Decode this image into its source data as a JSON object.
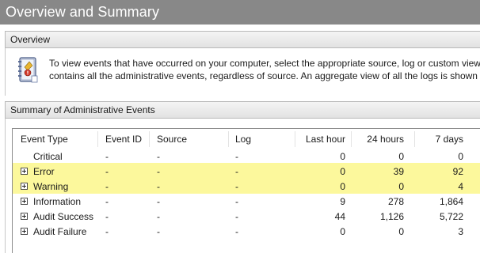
{
  "title": "Overview and Summary",
  "overview": {
    "header": "Overview",
    "icon": "event-log-book-icon",
    "line1": "To view events that have occurred on your computer, select the appropriate source, log or custom view",
    "line2": "contains all the administrative events, regardless of source. An aggregate view of all the logs is shown b"
  },
  "summary": {
    "header": "Summary of Administrative Events",
    "columns": {
      "event_type": "Event Type",
      "event_id": "Event ID",
      "source": "Source",
      "log": "Log",
      "last_hour": "Last hour",
      "h24": "24 hours",
      "d7": "7 days"
    },
    "rows": [
      {
        "type": "Critical",
        "event_id": "-",
        "source": "-",
        "log": "-",
        "last_hour": "0",
        "h24": "0",
        "d7": "0",
        "expandable": false,
        "highlight": false
      },
      {
        "type": "Error",
        "event_id": "-",
        "source": "-",
        "log": "-",
        "last_hour": "0",
        "h24": "39",
        "d7": "92",
        "expandable": true,
        "highlight": true
      },
      {
        "type": "Warning",
        "event_id": "-",
        "source": "-",
        "log": "-",
        "last_hour": "0",
        "h24": "0",
        "d7": "4",
        "expandable": true,
        "highlight": true
      },
      {
        "type": "Information",
        "event_id": "-",
        "source": "-",
        "log": "-",
        "last_hour": "9",
        "h24": "278",
        "d7": "1,864",
        "expandable": true,
        "highlight": false
      },
      {
        "type": "Audit Success",
        "event_id": "-",
        "source": "-",
        "log": "-",
        "last_hour": "44",
        "h24": "1,126",
        "d7": "5,722",
        "expandable": true,
        "highlight": false
      },
      {
        "type": "Audit Failure",
        "event_id": "-",
        "source": "-",
        "log": "-",
        "last_hour": "0",
        "h24": "0",
        "d7": "3",
        "expandable": true,
        "highlight": false
      }
    ],
    "highlight_color": "#fcf89c"
  },
  "colors": {
    "title_bar": "#888888",
    "section_header": "#e8e8e8"
  }
}
